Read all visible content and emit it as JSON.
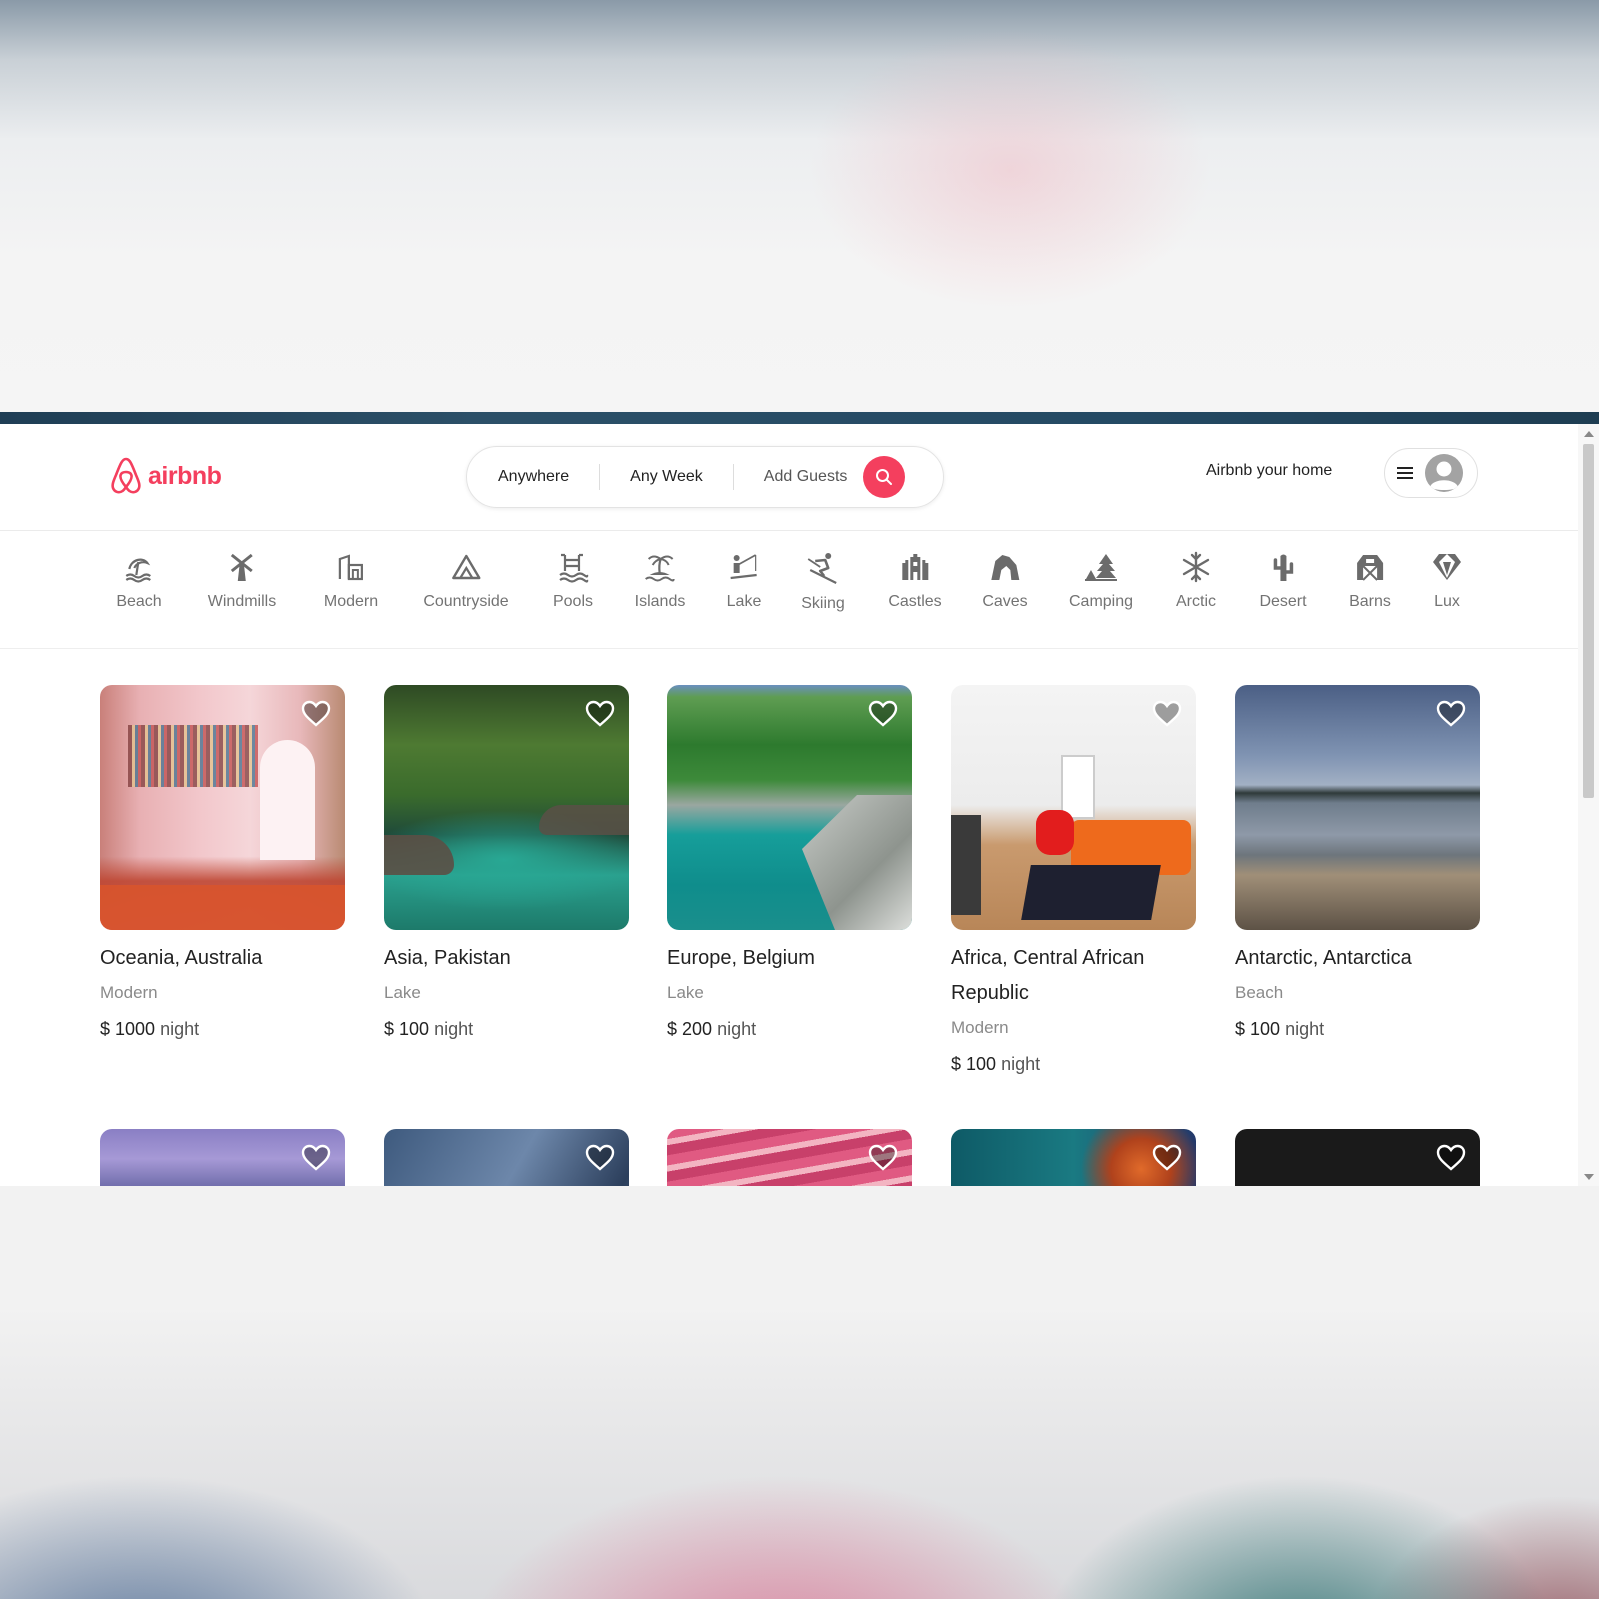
{
  "brand": {
    "name": "airbnb",
    "color": "#f43f5e"
  },
  "search": {
    "where": "Anywhere",
    "when": "Any Week",
    "guests": "Add Guests",
    "icon": "search-icon"
  },
  "header": {
    "host_link": "Airbnb your home",
    "menu_icon": "hamburger-icon",
    "avatar_icon": "user-avatar"
  },
  "categories": [
    {
      "label": "Beach",
      "icon": "beach-icon"
    },
    {
      "label": "Windmills",
      "icon": "windmill-icon"
    },
    {
      "label": "Modern",
      "icon": "modern-building-icon"
    },
    {
      "label": "Countryside",
      "icon": "mountain-icon"
    },
    {
      "label": "Pools",
      "icon": "pool-icon"
    },
    {
      "label": "Islands",
      "icon": "island-icon"
    },
    {
      "label": "Lake",
      "icon": "lake-fishing-icon"
    },
    {
      "label": "Skiing",
      "icon": "skiing-icon"
    },
    {
      "label": "Castles",
      "icon": "castle-icon"
    },
    {
      "label": "Caves",
      "icon": "cave-icon"
    },
    {
      "label": "Camping",
      "icon": "camping-icon"
    },
    {
      "label": "Arctic",
      "icon": "snowflake-icon"
    },
    {
      "label": "Desert",
      "icon": "cactus-icon"
    },
    {
      "label": "Barns",
      "icon": "barn-icon"
    },
    {
      "label": "Lux",
      "icon": "diamond-icon"
    }
  ],
  "listings": [
    {
      "location": "Oceania, Australia",
      "category": "Modern",
      "price": "$ 1000",
      "unit": "night"
    },
    {
      "location": "Asia, Pakistan",
      "category": "Lake",
      "price": "$ 100",
      "unit": "night"
    },
    {
      "location": "Europe, Belgium",
      "category": "Lake",
      "price": "$ 200",
      "unit": "night"
    },
    {
      "location": "Africa, Central African Republic",
      "category": "Modern",
      "price": "$ 100",
      "unit": "night"
    },
    {
      "location": "Antarctic, Antarctica",
      "category": "Beach",
      "price": "$ 100",
      "unit": "night"
    }
  ]
}
